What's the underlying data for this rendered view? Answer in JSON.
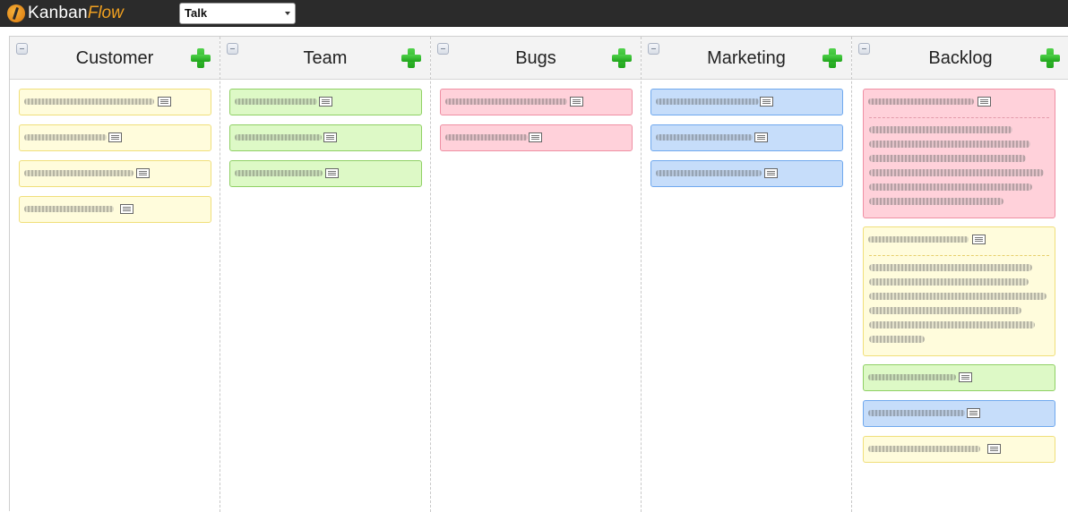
{
  "app": {
    "logo_primary": "Kanban",
    "logo_secondary": "Flow",
    "board_selector_value": "Talk"
  },
  "columns": [
    {
      "title": "Customer"
    },
    {
      "title": "Team"
    },
    {
      "title": "Bugs"
    },
    {
      "title": "Marketing"
    },
    {
      "title": "Backlog"
    }
  ],
  "icons": {
    "collapse": "collapse-minus-icon",
    "add": "add-plus-icon",
    "description": "description-note-icon"
  },
  "colors": {
    "topbar": "#2b2b2b",
    "logo_accent": "#f0a020",
    "card_yellow": "#fffcdc",
    "card_green": "#ddf9c6",
    "card_red": "#ffd1da",
    "card_blue": "#c6ddfa",
    "add_button": "#2ebd28"
  }
}
